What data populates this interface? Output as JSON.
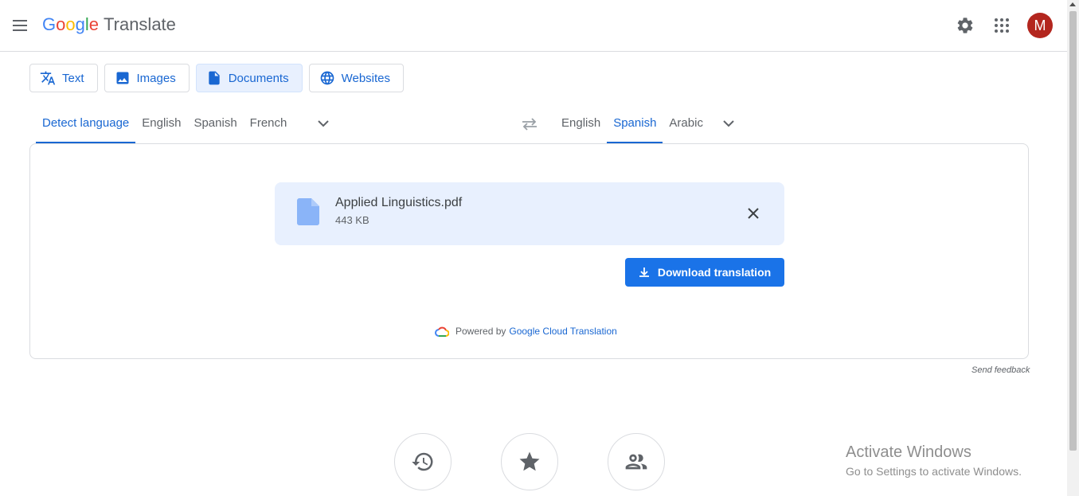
{
  "header": {
    "logo": {
      "G": "G",
      "o1": "o",
      "o2": "o",
      "g": "g",
      "l": "l",
      "e": "e",
      "suffix": "Translate"
    },
    "avatar_letter": "M",
    "icons": [
      "menu-icon",
      "settings-gear-icon",
      "apps-grid-icon"
    ]
  },
  "mode_tabs": [
    {
      "label": "Text",
      "icon": "translate-icon",
      "active": false
    },
    {
      "label": "Images",
      "icon": "image-icon",
      "active": false
    },
    {
      "label": "Documents",
      "icon": "document-icon",
      "active": true
    },
    {
      "label": "Websites",
      "icon": "globe-icon",
      "active": false
    }
  ],
  "source_languages": {
    "tabs": [
      {
        "label": "Detect language",
        "active": true
      },
      {
        "label": "English",
        "active": false
      },
      {
        "label": "Spanish",
        "active": false
      },
      {
        "label": "French",
        "active": false
      }
    ]
  },
  "target_languages": {
    "tabs": [
      {
        "label": "English",
        "active": false
      },
      {
        "label": "Spanish",
        "active": true
      },
      {
        "label": "Arabic",
        "active": false
      }
    ]
  },
  "document": {
    "file_name": "Applied Linguistics.pdf",
    "file_size": "443 KB",
    "download_label": "Download translation",
    "powered_by_prefix": "Powered by",
    "powered_by_link": "Google Cloud Translation"
  },
  "feedback_label": "Send feedback",
  "bottom_buttons": [
    "history-icon",
    "star-icon",
    "people-icon"
  ],
  "watermark": {
    "title": "Activate Windows",
    "subtitle": "Go to Settings to activate Windows."
  },
  "colors": {
    "accent": "#1a73e8",
    "active_tab_bg": "#e8f0fe",
    "avatar_bg": "#b3261e"
  }
}
